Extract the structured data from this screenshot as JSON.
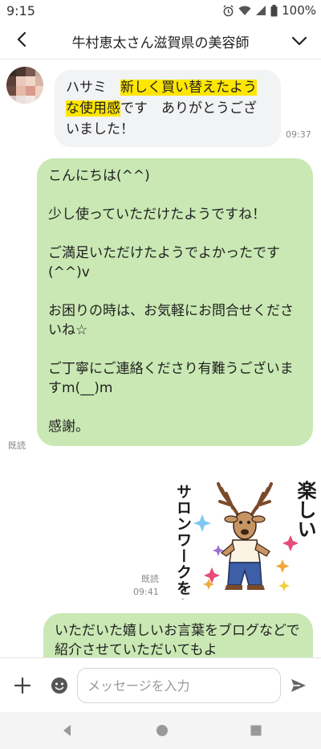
{
  "status": {
    "time": "9:15",
    "battery": "100%"
  },
  "header": {
    "title": "牛村恵太さん滋賀県の美容師"
  },
  "messages": {
    "incoming": {
      "part1": "ハサミ　",
      "highlight1": "新しく買い替えた",
      "highlight2": "ような使用感",
      "part2": "です　ありがとうございました！",
      "time": "09:37"
    },
    "outgoing1": {
      "lines": [
        "こんにちは(^^)",
        "少し使っていただけたようですね！",
        "ご満足いただけたようでよかったです",
        "(^^)v",
        "お困りの時は、お気軽にお問合せくださいね☆",
        "ご丁寧にご連絡くださり有難うございますm(__)m",
        "感謝。"
      ],
      "read": "既読"
    },
    "sticker": {
      "text_vertical": "サロンワークを♪",
      "text_right": "楽しい",
      "read": "既読",
      "time": "09:41"
    },
    "outgoing2": {
      "text": "いただいた嬉しいお言葉をブログなどで紹介させていただいてもよ"
    }
  },
  "input": {
    "placeholder": "メッセージを入力"
  },
  "colors": {
    "outgoing_bubble": "#c9e8b3",
    "incoming_bubble": "#f2f3f5",
    "highlight": "#ffe600"
  },
  "icons": [
    "back-icon",
    "chevron-down-icon",
    "plus-icon",
    "emoji-icon",
    "send-icon"
  ]
}
